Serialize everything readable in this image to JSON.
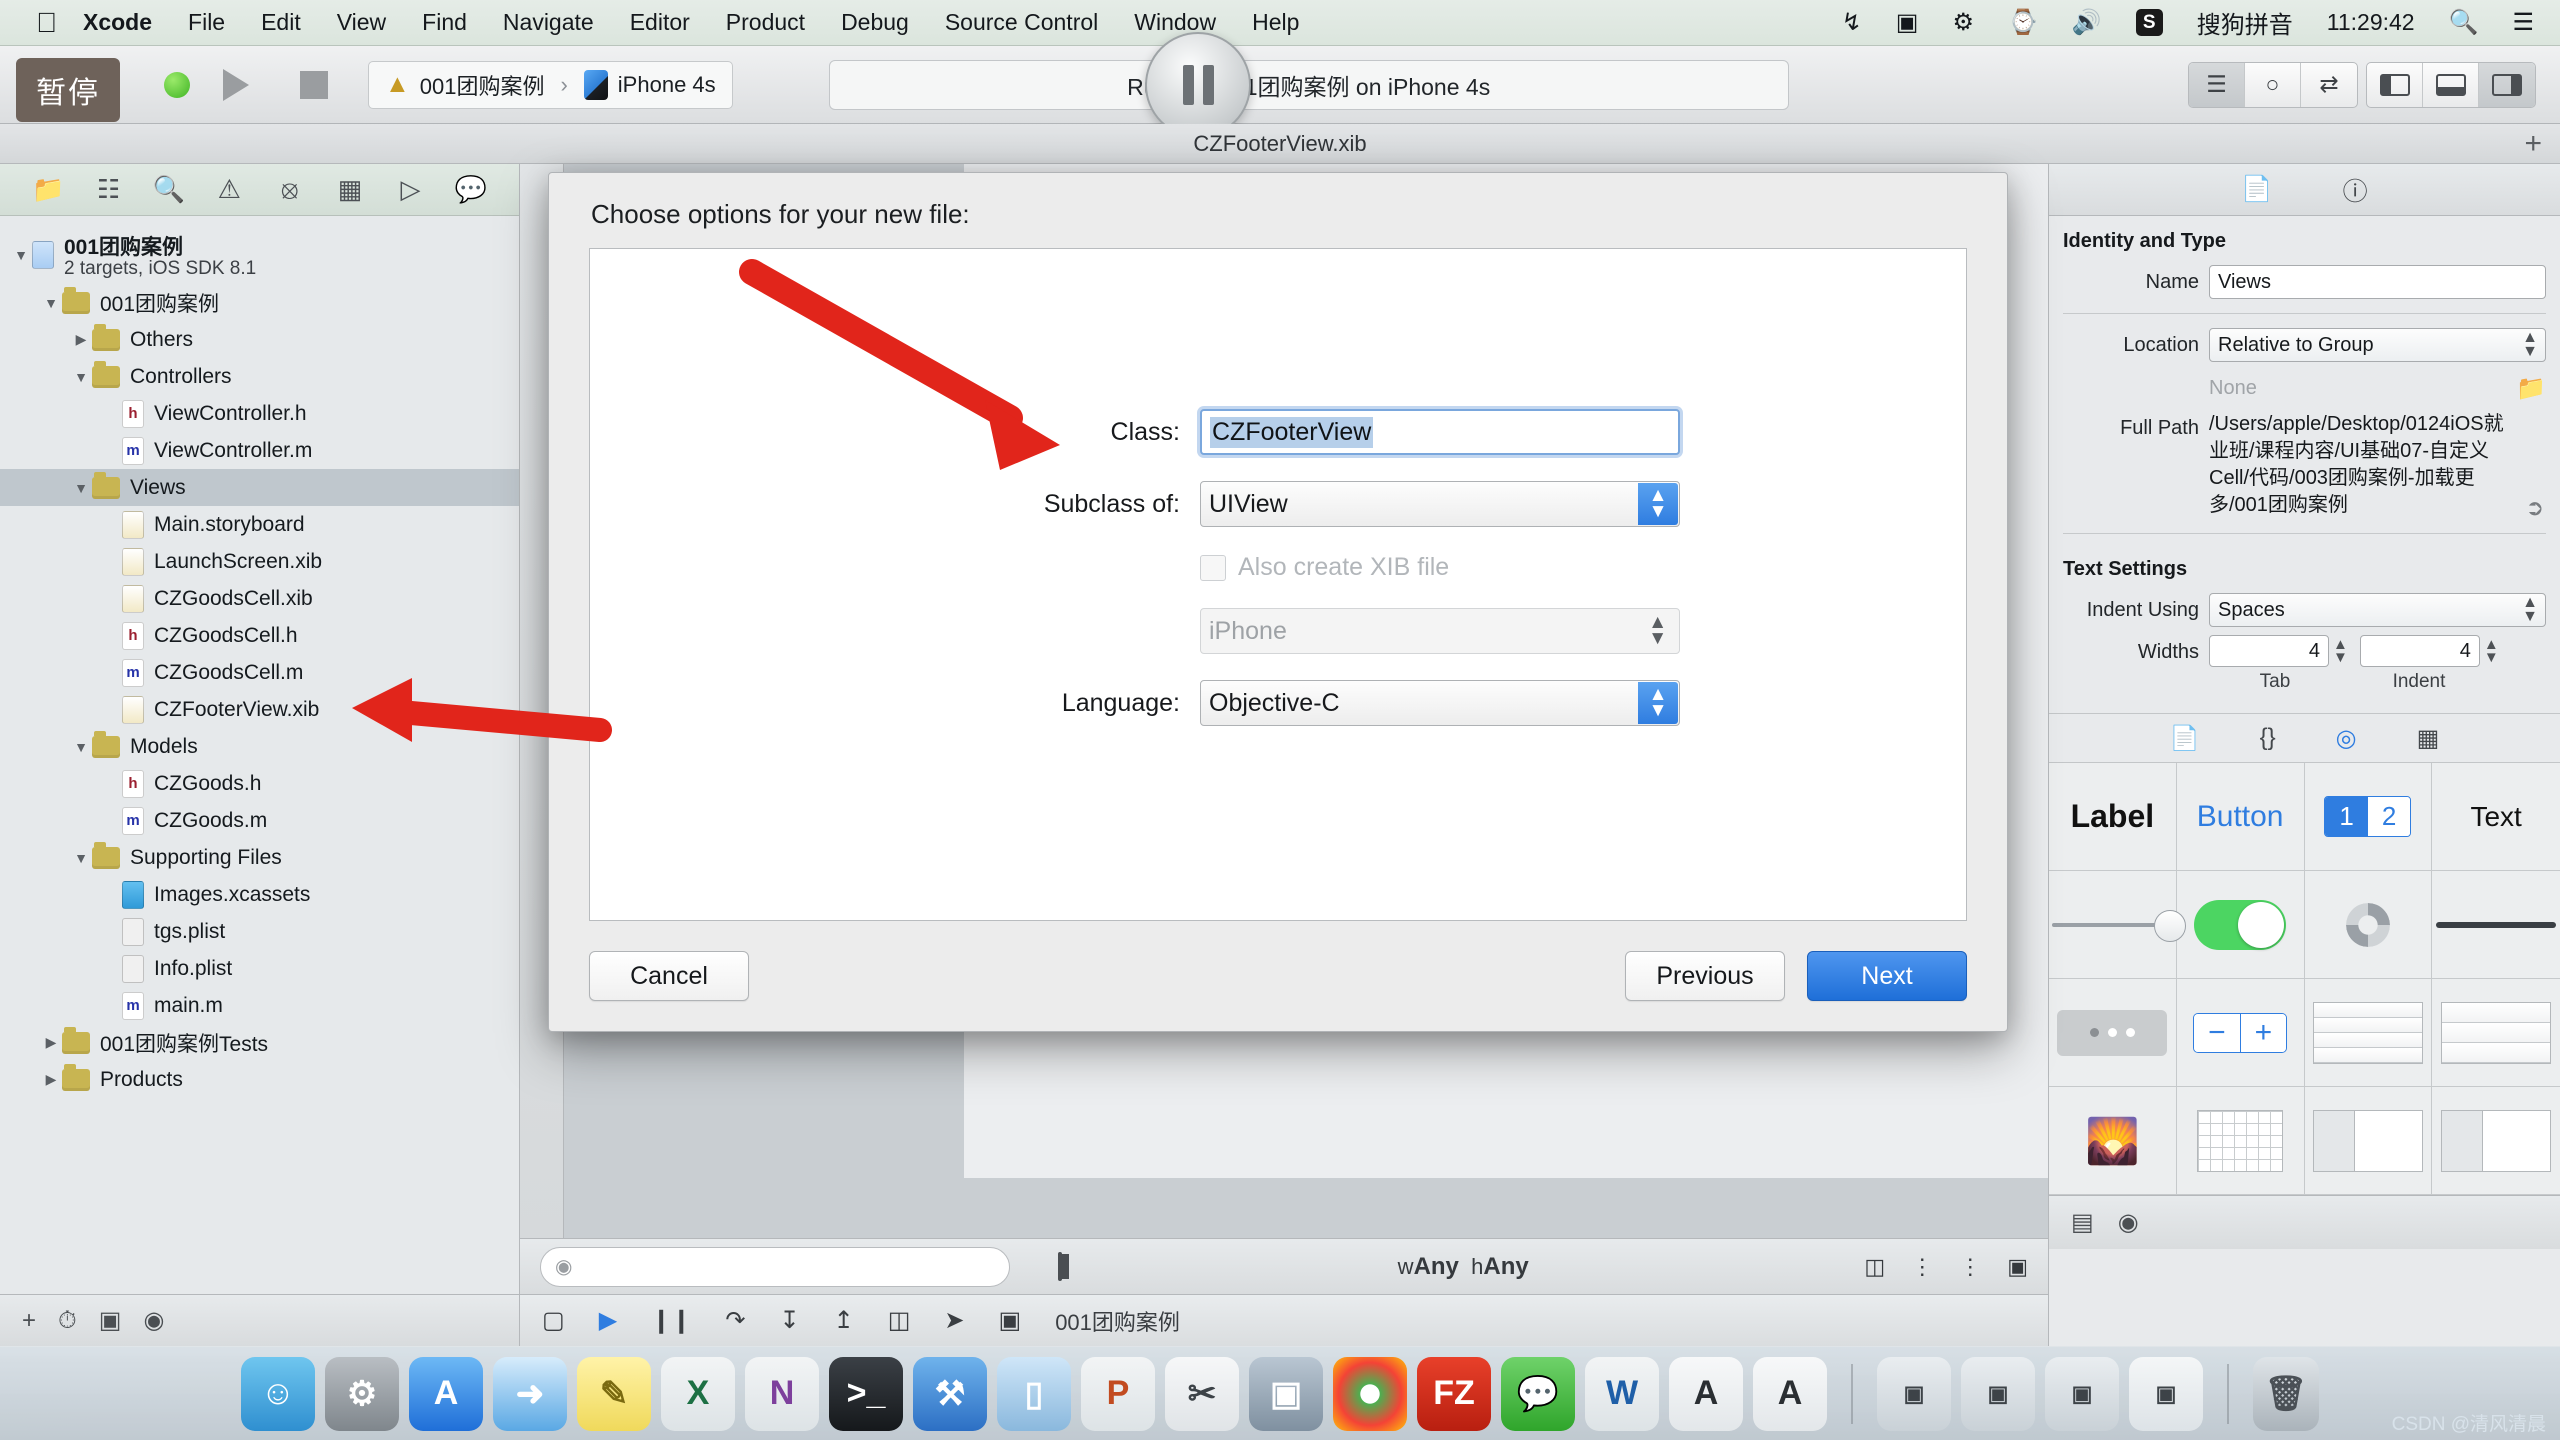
{
  "menubar": {
    "apple_icon": "apple-logo",
    "items": [
      "Xcode",
      "File",
      "Edit",
      "View",
      "Find",
      "Navigate",
      "Editor",
      "Product",
      "Debug",
      "Source Control",
      "Window",
      "Help"
    ],
    "status_items": [
      "airdrop-icon",
      "screen-record-icon",
      "bluetooth-icon",
      "time-machine-icon",
      "volume-icon"
    ],
    "input_method_badge": "S",
    "input_method": "搜狗拼音",
    "clock": "11:29:42",
    "search_icon": "spotlight-search-icon",
    "notification_icon": "notification-center-icon"
  },
  "toolbar": {
    "tooltip": "暂停",
    "run_icon": "play-icon",
    "stop_icon": "stop-icon",
    "scheme_name": "001团购案例",
    "scheme_separator": "›",
    "destination": "iPhone 4s",
    "status_text": "Running 001团购案例 on iPhone 4s",
    "pause_icon": "pause-icon",
    "editor_segments": [
      "standard-editor-icon",
      "assistant-editor-icon",
      "version-editor-icon"
    ],
    "view_segments": [
      "navigator-pane-icon",
      "debug-pane-icon",
      "utilities-pane-icon"
    ]
  },
  "document": {
    "title": "CZFooterView.xib",
    "add_icon": "plus-icon"
  },
  "navigator": {
    "tabs": [
      "folder-icon",
      "hierarchy-icon",
      "search-icon",
      "warning-icon",
      "issue-icon",
      "test-icon",
      "debug-icon",
      "breakpoint-icon",
      "report-icon"
    ],
    "tree": [
      {
        "indent": 0,
        "twisty": "down",
        "icon": "project-icon",
        "label": "001团购案例",
        "sub": "2 targets, iOS SDK 8.1",
        "selected": false
      },
      {
        "indent": 1,
        "twisty": "down",
        "icon": "folder",
        "label": "001团购案例",
        "sub": "",
        "selected": false
      },
      {
        "indent": 2,
        "twisty": "right",
        "icon": "folder",
        "label": "Others",
        "sub": "",
        "selected": false
      },
      {
        "indent": 2,
        "twisty": "down",
        "icon": "folder",
        "label": "Controllers",
        "sub": "",
        "selected": false
      },
      {
        "indent": 3,
        "twisty": "none",
        "icon": "h",
        "label": "ViewController.h",
        "sub": "",
        "selected": false
      },
      {
        "indent": 3,
        "twisty": "none",
        "icon": "m",
        "label": "ViewController.m",
        "sub": "",
        "selected": false
      },
      {
        "indent": 2,
        "twisty": "down",
        "icon": "folder",
        "label": "Views",
        "sub": "",
        "selected": true
      },
      {
        "indent": 3,
        "twisty": "none",
        "icon": "xib",
        "label": "Main.storyboard",
        "sub": "",
        "selected": false
      },
      {
        "indent": 3,
        "twisty": "none",
        "icon": "xib",
        "label": "LaunchScreen.xib",
        "sub": "",
        "selected": false
      },
      {
        "indent": 3,
        "twisty": "none",
        "icon": "xib",
        "label": "CZGoodsCell.xib",
        "sub": "",
        "selected": false
      },
      {
        "indent": 3,
        "twisty": "none",
        "icon": "h",
        "label": "CZGoodsCell.h",
        "sub": "",
        "selected": false
      },
      {
        "indent": 3,
        "twisty": "none",
        "icon": "m",
        "label": "CZGoodsCell.m",
        "sub": "",
        "selected": false
      },
      {
        "indent": 3,
        "twisty": "none",
        "icon": "xib",
        "label": "CZFooterView.xib",
        "sub": "",
        "selected": false
      },
      {
        "indent": 2,
        "twisty": "down",
        "icon": "folder",
        "label": "Models",
        "sub": "",
        "selected": false
      },
      {
        "indent": 3,
        "twisty": "none",
        "icon": "h",
        "label": "CZGoods.h",
        "sub": "",
        "selected": false
      },
      {
        "indent": 3,
        "twisty": "none",
        "icon": "m",
        "label": "CZGoods.m",
        "sub": "",
        "selected": false
      },
      {
        "indent": 2,
        "twisty": "down",
        "icon": "folder",
        "label": "Supporting Files",
        "sub": "",
        "selected": false
      },
      {
        "indent": 3,
        "twisty": "none",
        "icon": "xcassets",
        "label": "Images.xcassets",
        "sub": "",
        "selected": false
      },
      {
        "indent": 3,
        "twisty": "none",
        "icon": "plist",
        "label": "tgs.plist",
        "sub": "",
        "selected": false
      },
      {
        "indent": 3,
        "twisty": "none",
        "icon": "plist",
        "label": "Info.plist",
        "sub": "",
        "selected": false
      },
      {
        "indent": 3,
        "twisty": "none",
        "icon": "m",
        "label": "main.m",
        "sub": "",
        "selected": false
      },
      {
        "indent": 1,
        "twisty": "right",
        "icon": "folder",
        "label": "001团购案例Tests",
        "sub": "",
        "selected": false
      },
      {
        "indent": 1,
        "twisty": "right",
        "icon": "folder",
        "label": "Products",
        "sub": "",
        "selected": false
      }
    ],
    "footer_icons": [
      "add-icon",
      "filter-recent-icon",
      "filter-unsaved-icon",
      "filter-field-icon"
    ]
  },
  "editor": {
    "footer_search_placeholder": "",
    "size_class_w": "wAny",
    "size_class_h": "hAny",
    "size_class_prefix_w": "w",
    "size_class_prefix_h": "h",
    "align_icons": [
      "align-icon",
      "pin-icon",
      "resolve-issues-icon",
      "resizing-icon"
    ],
    "bottom_bar_icons": [
      "show-icon",
      "run-icon",
      "pause-icon",
      "step-over-icon",
      "step-into-icon",
      "step-out-icon",
      "simulate-icon",
      "location-icon"
    ],
    "bottom_bar_label": "001团购案例"
  },
  "inspector": {
    "tabs": [
      "file-inspector-icon",
      "quick-help-icon"
    ],
    "identity_section": "Identity and Type",
    "name_label": "Name",
    "name_value": "Views",
    "location_label": "Location",
    "location_value": "Relative to Group",
    "location_none": "None",
    "folder_icon": "folder-icon",
    "fullpath_label": "Full Path",
    "fullpath_value": "/Users/apple/Desktop/0124iOS就业班/课程内容/UI基础07-自定义Cell/代码/003团购案例-加载更多/001团购案例",
    "reveal_icon": "reveal-in-finder-icon",
    "text_section": "Text Settings",
    "indent_label": "Indent Using",
    "indent_value": "Spaces",
    "widths_label": "Widths",
    "tab_width": "4",
    "indent_width": "4",
    "tab_caption": "Tab",
    "indent_caption": "Indent",
    "library_tabs": [
      "file-template-library-icon",
      "code-snippet-library-icon",
      "object-library-icon",
      "media-library-icon"
    ],
    "library_items": [
      "Label",
      "Button",
      "1",
      "2",
      "Text"
    ],
    "footer_icons": [
      "list-view-icon",
      "filter-icon"
    ]
  },
  "dialog": {
    "title": "Choose options for your new file:",
    "class_label": "Class:",
    "class_value": "CZFooterView",
    "subclass_label": "Subclass of:",
    "subclass_value": "UIView",
    "xib_checkbox_label": "Also create XIB file",
    "xib_checked": false,
    "device_value": "iPhone",
    "language_label": "Language:",
    "language_value": "Objective-C",
    "cancel_label": "Cancel",
    "previous_label": "Previous",
    "next_label": "Next",
    "accent_color": "#2f7de0"
  },
  "annotations": {
    "arrow_color": "#e1251b",
    "arrow1_target": "class-name-field",
    "arrow2_target": "czfooterview-xib-file"
  },
  "dock": {
    "apps": [
      "finder",
      "system-preferences",
      "app-store",
      "safari",
      "notes",
      "excel",
      "onenote",
      "terminal",
      "xcode",
      "simulator",
      "powerpoint",
      "snipping",
      "screen",
      "chrome",
      "filezilla",
      "wechat",
      "word",
      "appA",
      "appB"
    ],
    "windows": [
      "window-1",
      "window-2",
      "window-3",
      "window-4"
    ],
    "trash": "trash-icon"
  },
  "watermark": "CSDN @清风清晨"
}
